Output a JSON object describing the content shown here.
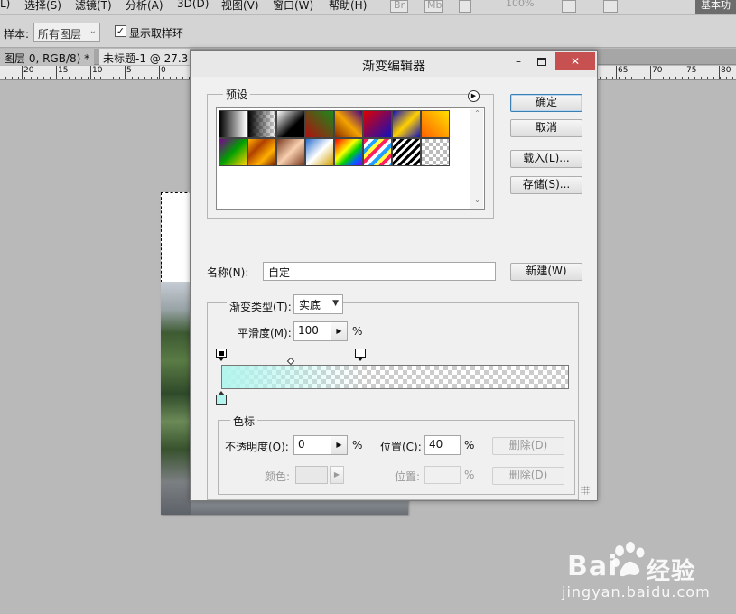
{
  "menu": {
    "items": [
      "L)",
      "选择(S)",
      "滤镜(T)",
      "分析(A)",
      "3D(D)",
      "视图(V)",
      "窗口(W)",
      "帮助(H)"
    ],
    "br_label": "Br",
    "mb_label": "Mb",
    "zoom": "100%",
    "workspace_label": "基本功"
  },
  "options": {
    "sample_label": "样本:",
    "sample_value": "所有图层",
    "show_ring_checked": true,
    "show_ring_label": "显示取样环"
  },
  "tabs": [
    {
      "label": "图层 0, RGB/8) *"
    },
    {
      "label": "未标题-1 @ 27.3"
    }
  ],
  "ruler_left": [
    "20",
    "15",
    "10",
    "5",
    "0"
  ],
  "ruler_right": [
    "65",
    "70",
    "75",
    "80"
  ],
  "dialog": {
    "title": "渐变编辑器",
    "presets_label": "预设",
    "ok": "确定",
    "cancel": "取消",
    "load": "载入(L)...",
    "save": "存储(S)...",
    "name_label": "名称(N):",
    "name_value": "自定",
    "new_button": "新建(W)",
    "gradient_type_label": "渐变类型(T):",
    "gradient_type_value": "实底",
    "smoothness_label": "平滑度(M):",
    "smoothness_value": "100",
    "percent": "%",
    "stops_label": "色标",
    "opacity_label": "不透明度(O):",
    "opacity_value": "0",
    "location_label": "位置(C):",
    "location_value": "40",
    "delete1": "删除(D)",
    "color_label": "颜色:",
    "location2_label": "位置:",
    "delete2": "删除(D)"
  },
  "gradient": {
    "start_color": "#b3f5ee",
    "opacity_stops": [
      0,
      40
    ],
    "color_stops": [
      0
    ],
    "midpoint": 20
  },
  "colors": {
    "close_button": "#c75050",
    "primary_border": "#3c7fb1"
  },
  "watermark": {
    "brand": "Bai",
    "suffix": "经验",
    "url": "jingyan.baidu.com"
  }
}
